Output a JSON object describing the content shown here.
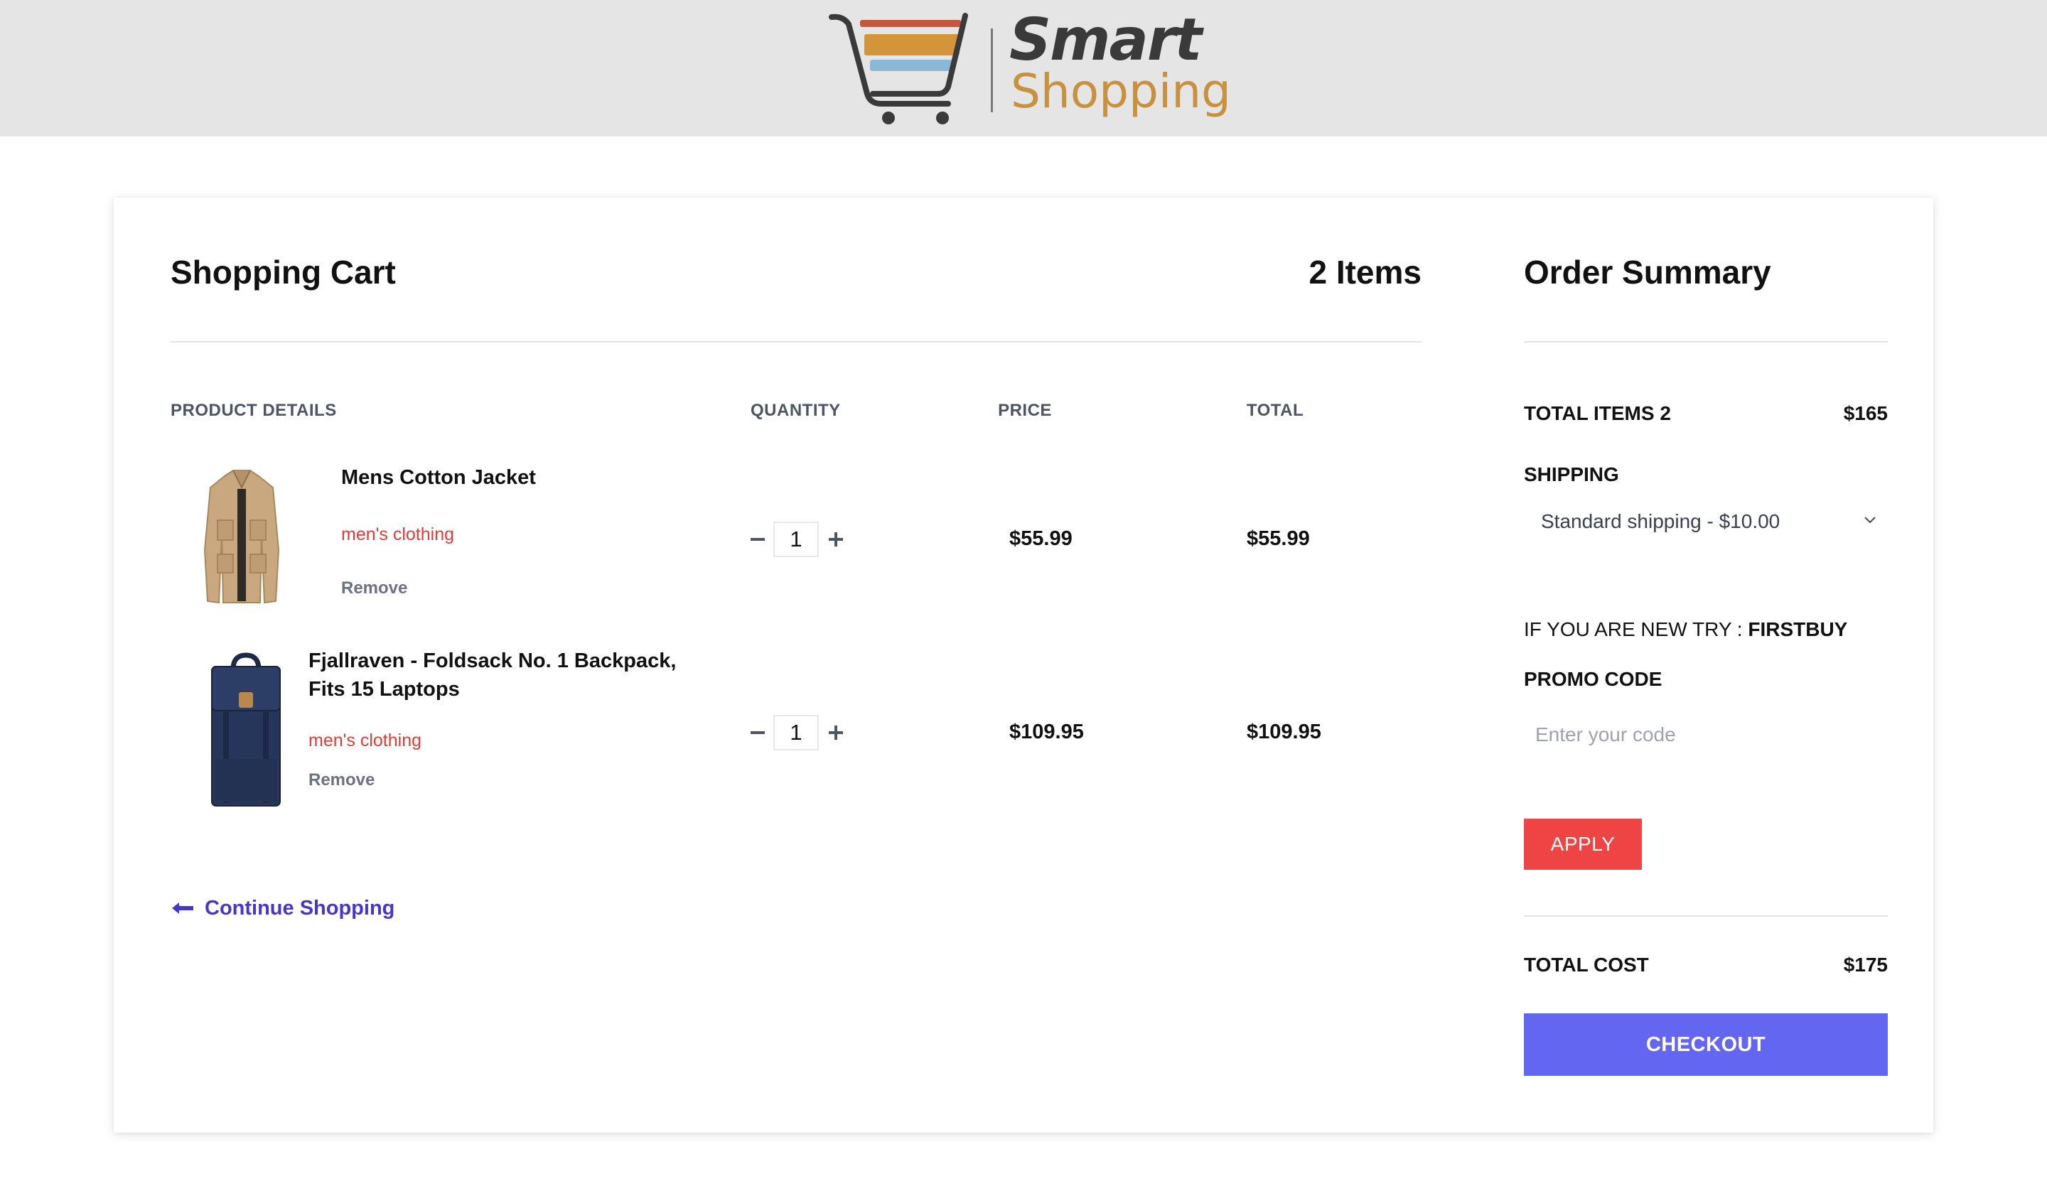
{
  "header": {
    "logo_word_1": "Smart",
    "logo_word_2": "Shopping",
    "logo_colors": {
      "dark": "#3a3a3a",
      "gold": "#c8913f",
      "stripe_red": "#c7553f",
      "stripe_gold": "#d4953a",
      "stripe_blue": "#8cb8d8"
    }
  },
  "cart": {
    "title": "Shopping Cart",
    "items_count": "2 Items",
    "columns": {
      "product": "PRODUCT DETAILS",
      "quantity": "QUANTITY",
      "price": "PRICE",
      "total": "TOTAL"
    },
    "items": [
      {
        "name": "Mens Cotton Jacket",
        "category": "men's clothing",
        "remove_label": "Remove",
        "quantity": "1",
        "price": "$55.99",
        "total": "$55.99",
        "image": "jacket"
      },
      {
        "name": "Fjallraven - Foldsack No. 1 Backpack, Fits 15 Laptops",
        "category": "men's clothing",
        "remove_label": "Remove",
        "quantity": "1",
        "price": "$109.95",
        "total": "$109.95",
        "image": "backpack"
      }
    ],
    "continue_label": "Continue Shopping"
  },
  "summary": {
    "title": "Order Summary",
    "total_items_label": "TOTAL ITEMS 2",
    "total_items_value": "$165",
    "shipping_label": "SHIPPING",
    "shipping_selected": "Standard shipping - $10.00",
    "promo_hint_prefix": "IF YOU ARE NEW TRY :",
    "promo_hint_code": "FIRSTBUY",
    "promo_label": "PROMO CODE",
    "promo_placeholder": "Enter your code",
    "apply_label": "APPLY",
    "total_cost_label": "TOTAL COST",
    "total_cost_value": "$175",
    "checkout_label": "CHECKOUT"
  },
  "colors": {
    "header_bg": "#e5e5e5",
    "category_red": "#e53935",
    "apply_red": "#ef4444",
    "checkout_indigo": "#6366f1",
    "link_indigo": "#4338ca"
  }
}
